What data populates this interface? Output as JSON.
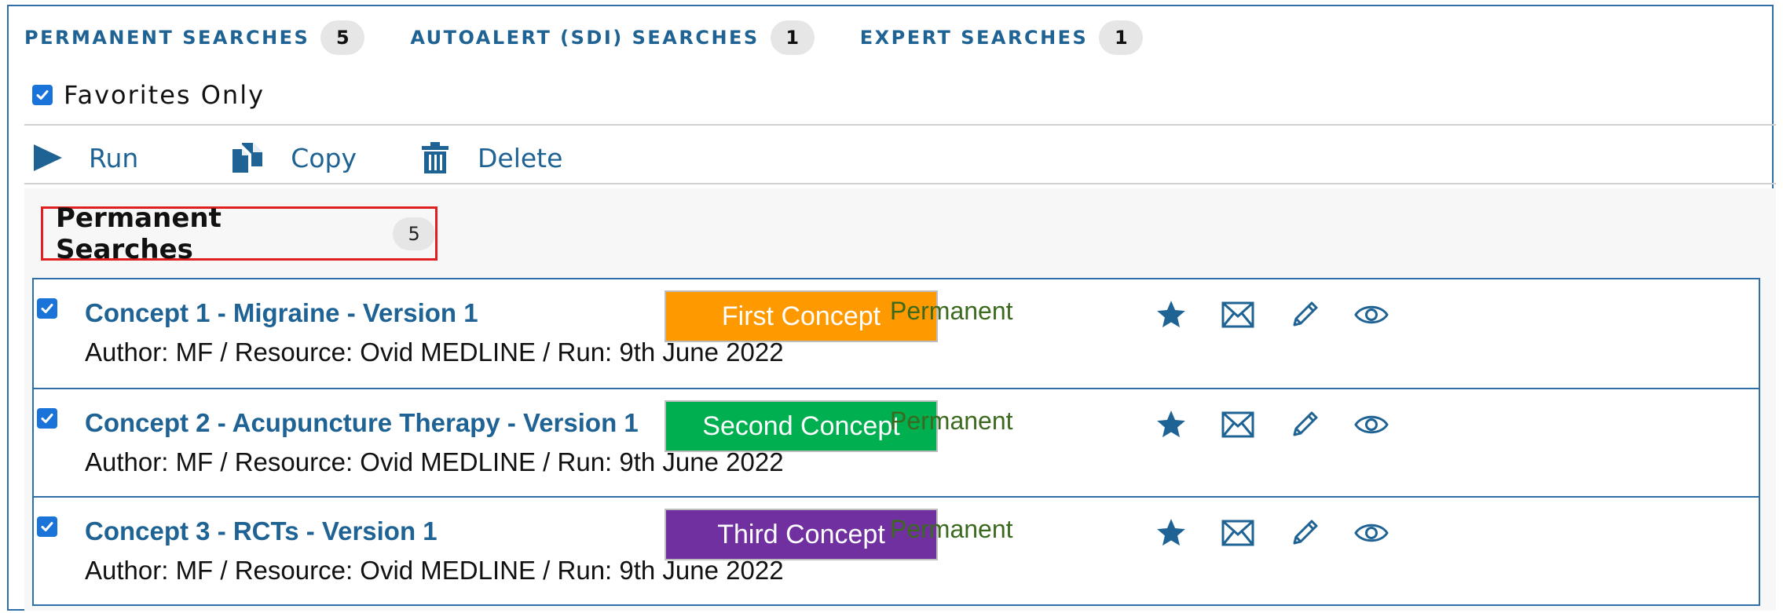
{
  "tabs": [
    {
      "label": "PERMANENT SEARCHES",
      "count": "5"
    },
    {
      "label": "AUTOALERT (SDI) SEARCHES",
      "count": "1"
    },
    {
      "label": "EXPERT SEARCHES",
      "count": "1"
    }
  ],
  "favorites": {
    "label": "Favorites Only",
    "checked": true
  },
  "toolbar": {
    "run_label": "Run",
    "copy_label": "Copy",
    "delete_label": "Delete"
  },
  "section": {
    "title": "Permanent Searches",
    "count": "5"
  },
  "rows": [
    {
      "title": "Concept 1 - Migraine - Version 1",
      "meta": "Author: MF / Resource: Ovid MEDLINE / Run: 9th June 2022",
      "tag": "First Concept",
      "tag_color": "#ff9900",
      "type": "Permanent"
    },
    {
      "title": "Concept 2 - Acupuncture Therapy - Version 1",
      "meta": "Author: MF / Resource: Ovid MEDLINE / Run: 9th June 2022",
      "tag": "Second Concept",
      "tag_color": "#00b050",
      "type": "Permanent"
    },
    {
      "title": "Concept 3 - RCTs - Version 1",
      "meta": "Author: MF / Resource: Ovid MEDLINE / Run: 9th June 2022",
      "tag": "Third Concept",
      "tag_color": "#7030a0",
      "type": "Permanent"
    }
  ],
  "colors": {
    "accent": "#1f6394",
    "border": "#2f6ea6",
    "highlight": "#e02020"
  },
  "icons": {
    "run": "play-icon",
    "copy": "copy-icon",
    "delete": "trash-icon",
    "row_actions": [
      "star-icon",
      "envelope-icon",
      "pencil-icon",
      "eye-icon"
    ]
  }
}
